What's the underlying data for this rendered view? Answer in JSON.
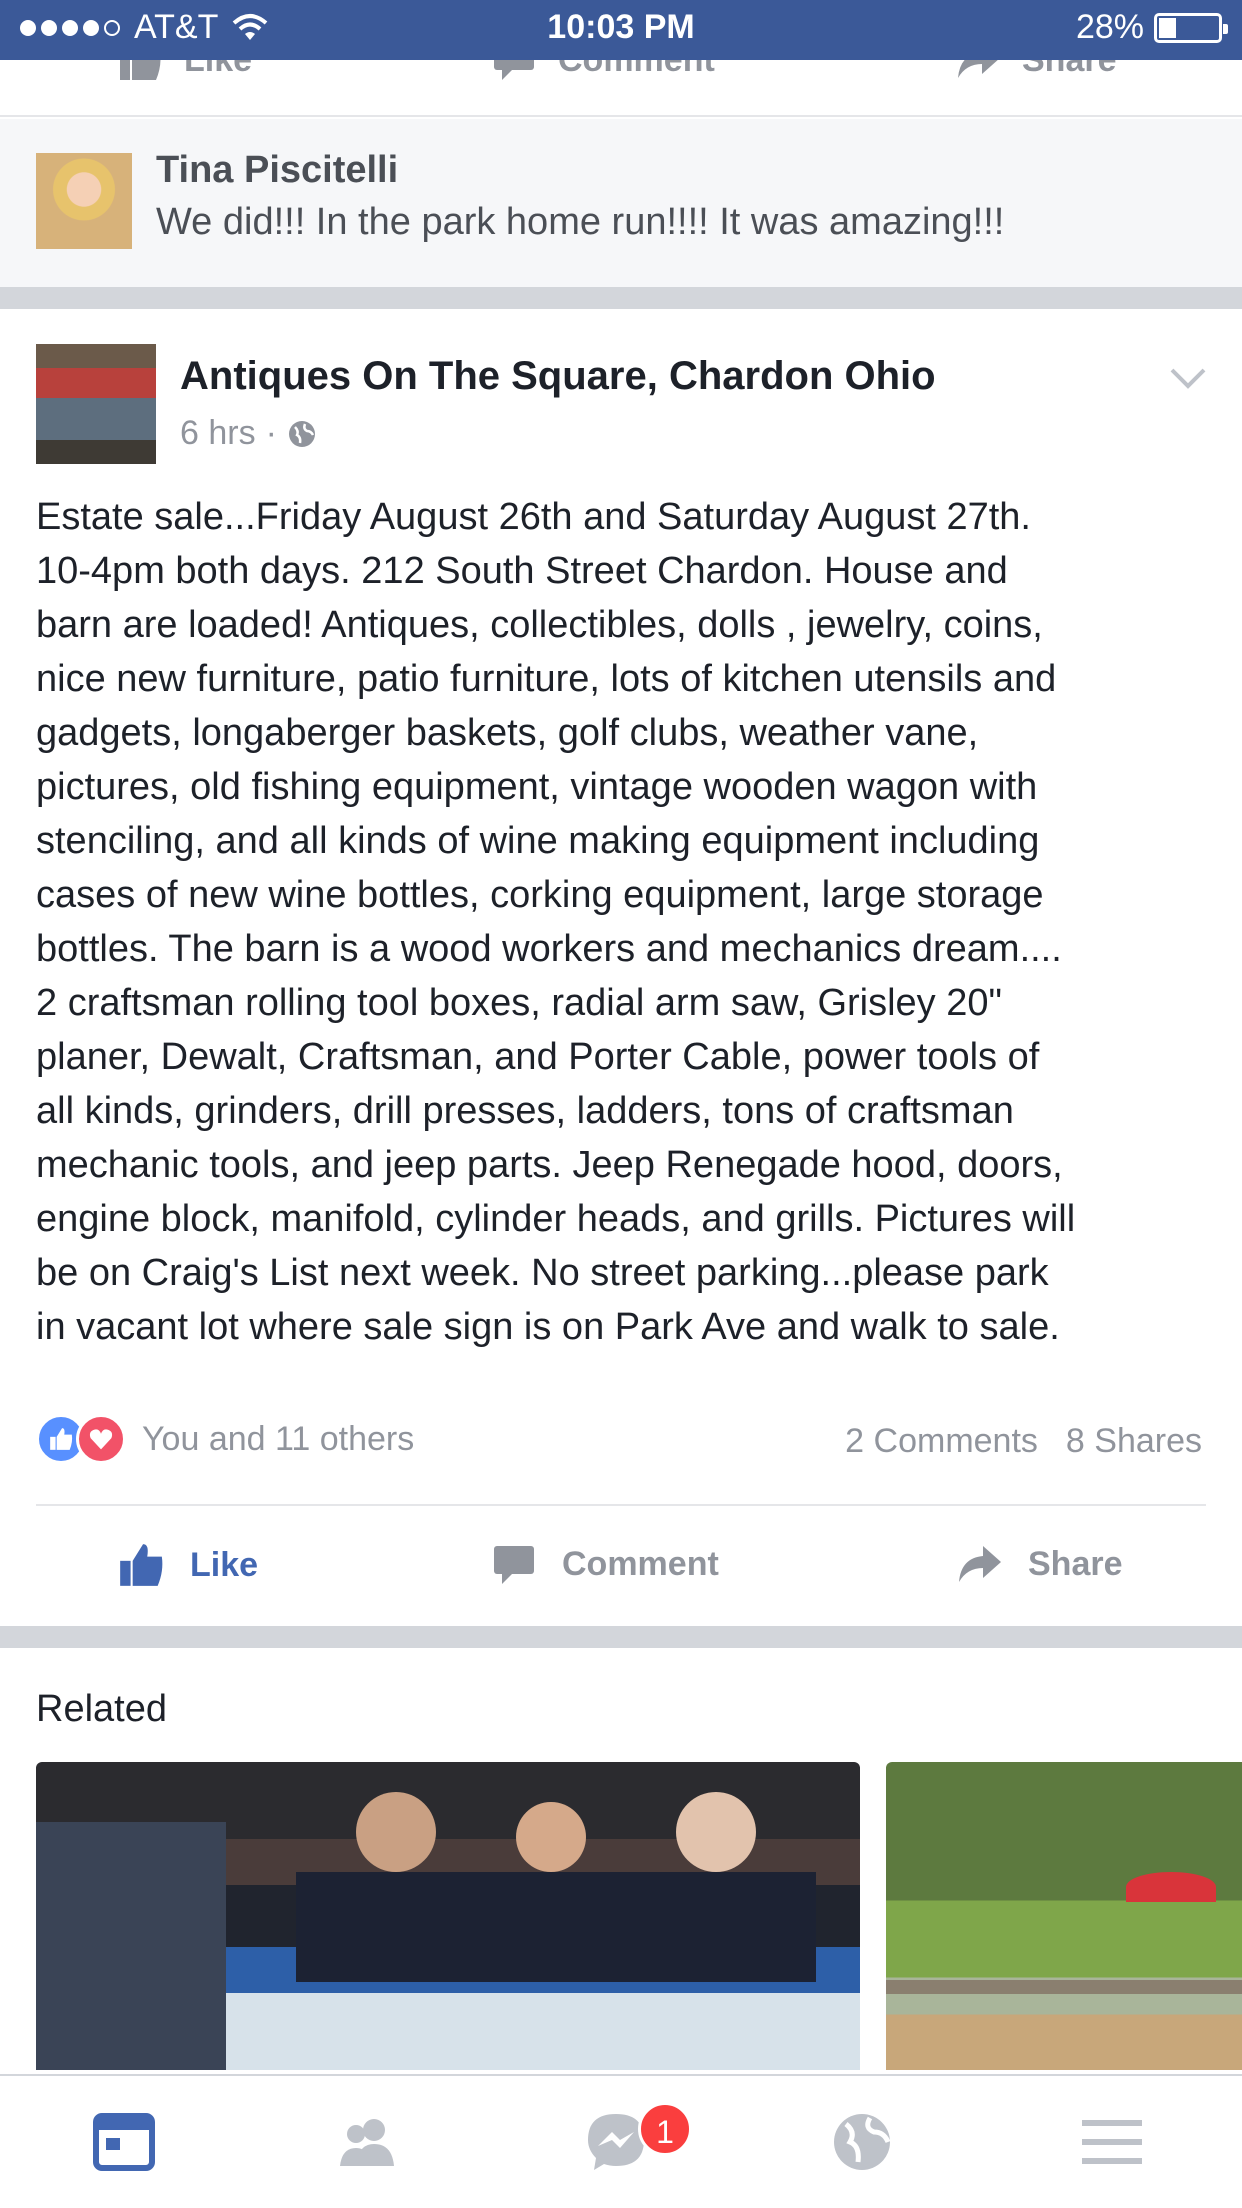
{
  "status_bar": {
    "carrier": "AT&T",
    "time": "10:03 PM",
    "battery": "28%",
    "battery_level": 0.28
  },
  "top_actions": {
    "like": "Like",
    "comment": "Comment",
    "share": "Share"
  },
  "comment": {
    "author": "Tina Piscitelli",
    "text": "We did!!! In the park home run!!!! It was amazing!!!"
  },
  "post": {
    "author": "Antiques On The Square,  Chardon Ohio",
    "time": "6 hrs",
    "privacy_icon": "globe-icon",
    "lines": [
      "Estate sale...Friday August 26th and Saturday August 27th.",
      "10-4pm both days.  212 South Street Chardon. House and",
      "barn are loaded! Antiques, collectibles, dolls , jewelry, coins,",
      "nice new furniture, patio furniture, lots of kitchen utensils and",
      "gadgets, longaberger baskets, golf clubs, weather vane,",
      "pictures, old fishing equipment, vintage wooden wagon with",
      "stenciling, and all kinds of wine making equipment including",
      "cases of new wine bottles, corking equipment, large storage",
      "bottles. The barn is a wood workers and mechanics dream....",
      "2 craftsman rolling tool boxes, radial arm saw, Grisley 20\"",
      "planer, Dewalt, Craftsman, and Porter Cable, power tools of",
      "all kinds, grinders, drill presses, ladders, tons of craftsman",
      "mechanic tools, and jeep parts. Jeep Renegade hood, doors,",
      "engine block, manifold, cylinder heads, and grills. Pictures will",
      "be on Craig's List next week. No street parking...please park",
      "in vacant lot  where sale sign is on Park Ave and walk to sale."
    ],
    "reactions_text": "You and 11 others",
    "comments_count": "2 Comments",
    "shares_count": "8 Shares",
    "actions": {
      "like": "Like",
      "comment": "Comment",
      "share": "Share"
    }
  },
  "related": {
    "title": "Related"
  },
  "tab_bar": {
    "tabs": [
      "news-feed-icon",
      "friends-icon",
      "messenger-icon",
      "globe-icon",
      "menu-icon"
    ],
    "messenger_badge": "1"
  },
  "colors": {
    "brand": "#3b5998",
    "like_blue": "#4267b2",
    "love_red": "#f25268",
    "badge_red": "#fa3e3e"
  }
}
